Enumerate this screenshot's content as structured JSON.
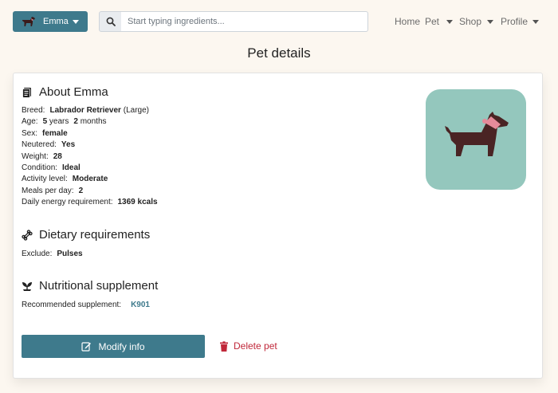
{
  "header": {
    "pet_selector": {
      "name": "Emma"
    },
    "search": {
      "placeholder": "Start typing ingredients..."
    },
    "nav": {
      "home": "Home",
      "pet": "Pet",
      "shop": "Shop",
      "profile": "Profile"
    }
  },
  "page": {
    "title": "Pet details"
  },
  "about": {
    "title": "About Emma",
    "breed_label": "Breed:",
    "breed_value": "Labrador Retriever",
    "breed_size": "(Large)",
    "age_label": "Age:",
    "age_years": "5",
    "age_years_unit": "years",
    "age_months": "2",
    "age_months_unit": "months",
    "sex_label": "Sex:",
    "sex_value": "female",
    "neutered_label": "Neutered:",
    "neutered_value": "Yes",
    "weight_label": "Weight:",
    "weight_value": "28",
    "condition_label": "Condition:",
    "condition_value": "Ideal",
    "activity_label": "Activity level:",
    "activity_value": "Moderate",
    "meals_label": "Meals per day:",
    "meals_value": "2",
    "energy_label": "Daily energy requirement:",
    "energy_value": "1369 kcals"
  },
  "dietary": {
    "title": "Dietary requirements",
    "exclude_label": "Exclude:",
    "exclude_value": "Pulses"
  },
  "supplement": {
    "title": "Nutritional supplement",
    "recommended_label": "Recommended supplement:",
    "recommended_value": "K901"
  },
  "actions": {
    "modify": "Modify info",
    "delete": "Delete pet"
  },
  "colors": {
    "accent": "#3e7a8c",
    "danger": "#c0283a",
    "avatar_bg": "#94c7bd",
    "background": "#fcf7f0"
  }
}
